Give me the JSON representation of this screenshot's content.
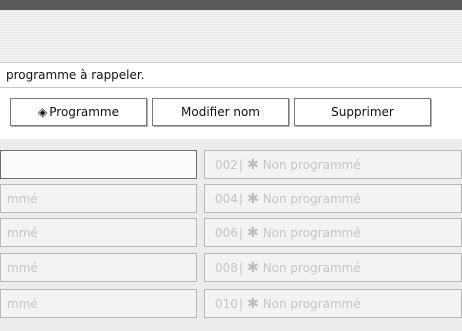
{
  "instruction": "programme à rappeler.",
  "tabs": {
    "program": {
      "label": "Programme",
      "icon": "diamond-arrow-icon"
    },
    "rename": {
      "label": "Modifier nom"
    },
    "delete": {
      "label": "Supprimer"
    }
  },
  "slots": {
    "left": [
      {
        "label": ""
      },
      {
        "label": "mmé"
      },
      {
        "label": "mmé"
      },
      {
        "label": "mmé"
      },
      {
        "label": "mmé"
      }
    ],
    "right": [
      {
        "number": "002",
        "label": "Non programmé"
      },
      {
        "number": "004",
        "label": "Non programmé"
      },
      {
        "number": "006",
        "label": "Non programmé"
      },
      {
        "number": "008",
        "label": "Non programmé"
      },
      {
        "number": "010",
        "label": "Non programmé"
      }
    ]
  },
  "colors": {
    "top_bar": "#5a5a5a",
    "slot_text": "#c6c6c6"
  }
}
